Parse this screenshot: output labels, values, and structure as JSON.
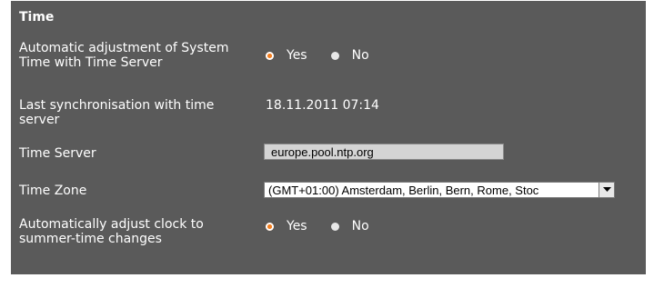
{
  "section": {
    "title": "Time"
  },
  "auto_adjust": {
    "label": "Automatic adjustment of System Time with Time Server",
    "yes_label": "Yes",
    "no_label": "No",
    "selected": "yes"
  },
  "last_sync": {
    "label": "Last synchronisation with time server",
    "value": "18.11.2011 07:14"
  },
  "time_server": {
    "label": "Time Server",
    "value": "europe.pool.ntp.org"
  },
  "time_zone": {
    "label": "Time Zone",
    "value": "(GMT+01:00) Amsterdam, Berlin, Bern, Rome, Stoc"
  },
  "summer_time": {
    "label": "Automatically adjust clock to summer-time changes",
    "yes_label": "Yes",
    "no_label": "No",
    "selected": "yes"
  },
  "colors": {
    "panel_bg": "#5a5a5a",
    "radio_selected": "#f47f20",
    "radio_unselected": "#e8e8e8"
  }
}
